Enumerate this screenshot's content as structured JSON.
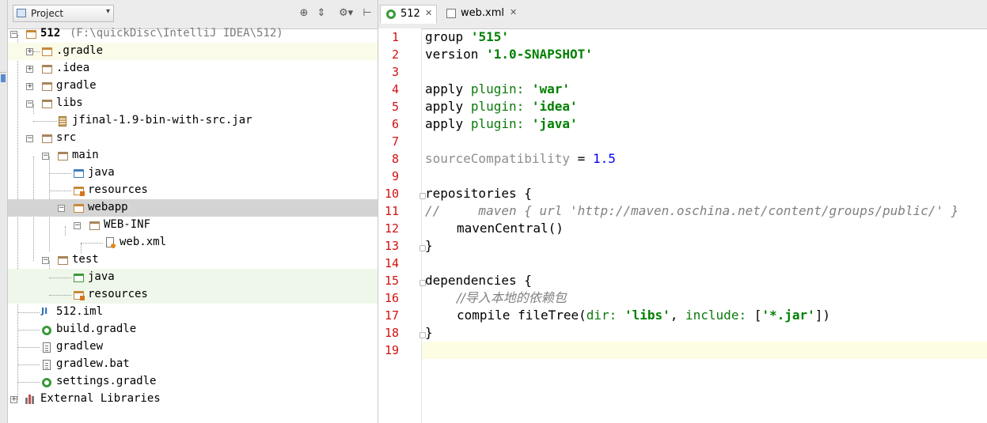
{
  "project_panel": {
    "view_selector": "Project",
    "tree": [
      {
        "name": "512",
        "path": "(F:\\quickDisc\\IntelliJ IDEA\\512)"
      },
      {
        "name": ".gradle"
      },
      {
        "name": ".idea"
      },
      {
        "name": "gradle"
      },
      {
        "name": "libs"
      },
      {
        "name": "jfinal-1.9-bin-with-src.jar"
      },
      {
        "name": "src"
      },
      {
        "name": "main"
      },
      {
        "name": "java"
      },
      {
        "name": "resources"
      },
      {
        "name": "webapp"
      },
      {
        "name": "WEB-INF"
      },
      {
        "name": "web.xml"
      },
      {
        "name": "test"
      },
      {
        "name": "java"
      },
      {
        "name": "resources"
      },
      {
        "name": "512.iml"
      },
      {
        "name": "build.gradle"
      },
      {
        "name": "gradlew"
      },
      {
        "name": "gradlew.bat"
      },
      {
        "name": "settings.gradle"
      },
      {
        "name": "External Libraries"
      }
    ]
  },
  "editor": {
    "tabs": [
      {
        "label": "512",
        "active": true
      },
      {
        "label": "web.xml",
        "active": false
      }
    ],
    "line_numbers": [
      "1",
      "2",
      "3",
      "4",
      "5",
      "6",
      "7",
      "8",
      "9",
      "10",
      "11",
      "12",
      "13",
      "14",
      "15",
      "16",
      "17",
      "18",
      "19"
    ],
    "code": {
      "l1_kw": "group",
      "l1_str": "'515'",
      "l2_kw": "version",
      "l2_str": "'1.0-SNAPSHOT'",
      "l4_kw": "apply",
      "l4_p": "plugin:",
      "l4_str": "'war'",
      "l5_kw": "apply",
      "l5_p": "plugin:",
      "l5_str": "'idea'",
      "l6_kw": "apply",
      "l6_p": "plugin:",
      "l6_str": "'java'",
      "l8_kw": "sourceCompatibility",
      "l8_eq": "=",
      "l8_num": "1.5",
      "l10": "repositories {",
      "l11": "//     maven { url 'http://maven.oschina.net/content/groups/public/' }",
      "l12": "mavenCentral()",
      "l13": "}",
      "l15": "dependencies {",
      "l16": "//导入本地的依赖包",
      "l17_a": "compile",
      "l17_b": "fileTree(",
      "l17_c": "dir:",
      "l17_d": "'libs'",
      "l17_e": ", ",
      "l17_f": "include:",
      "l17_g": " [",
      "l17_h": "'*.jar'",
      "l17_i": "])",
      "l18": "}"
    }
  },
  "colors": {
    "line_number": "#d11111",
    "string": "#008000",
    "number": "#0000ff",
    "selection": "#d4d4d4",
    "current_line": "#fdfde4"
  }
}
